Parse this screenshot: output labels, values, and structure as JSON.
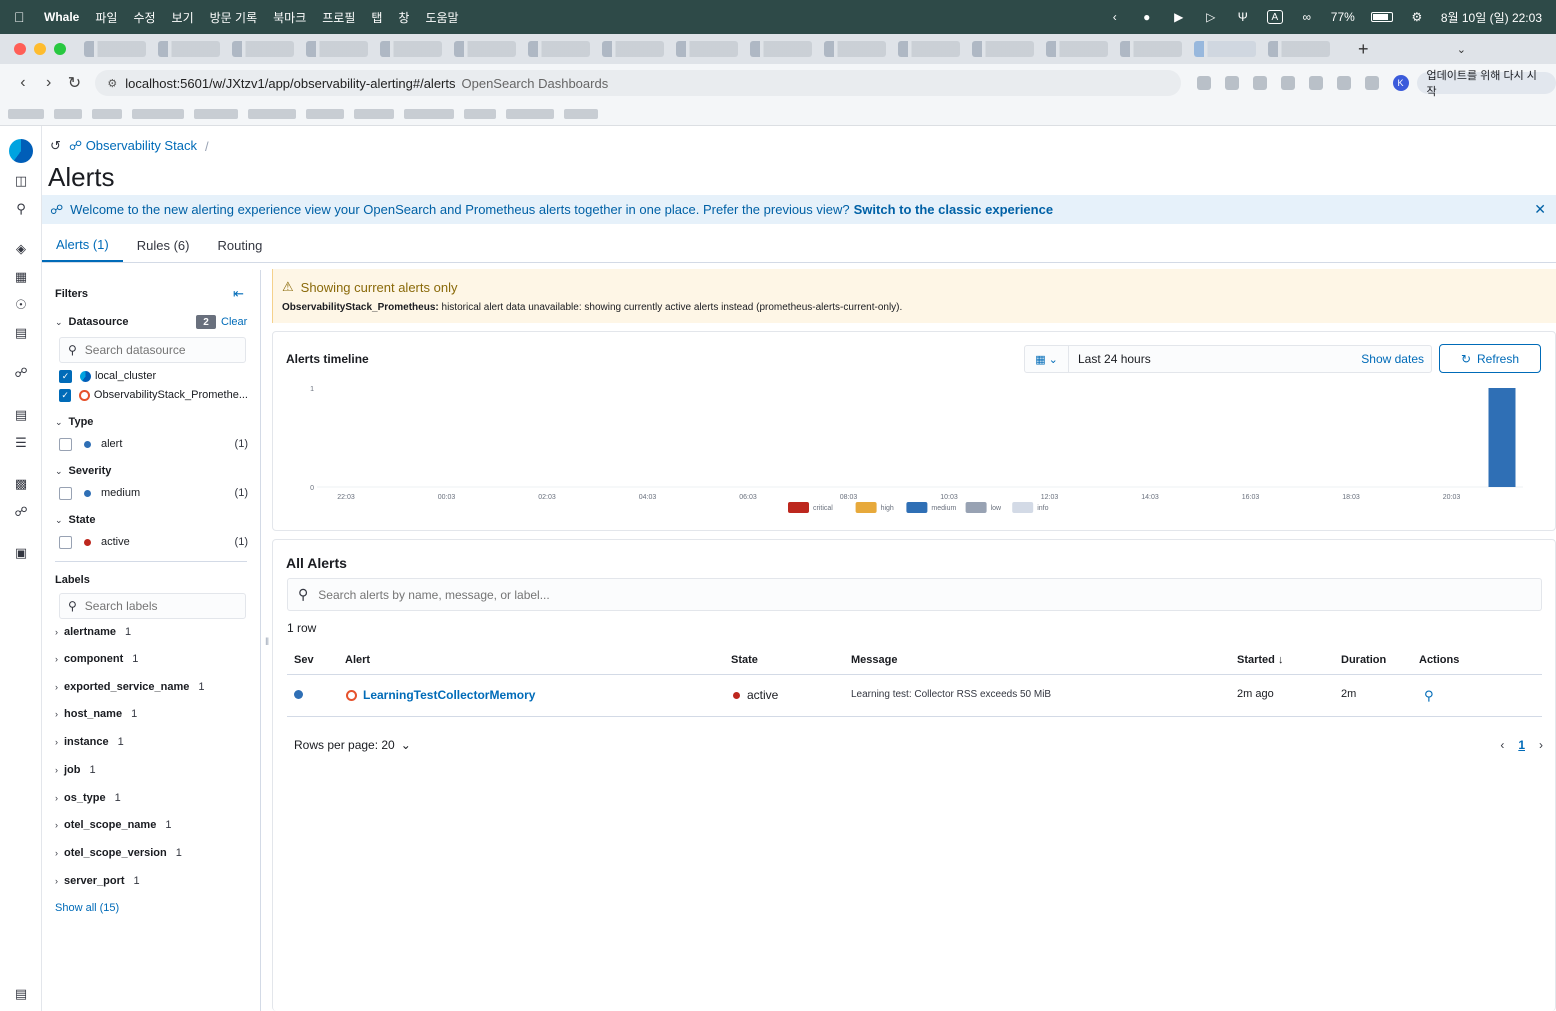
{
  "os_menubar": {
    "app_name": "Whale",
    "menus": [
      "파일",
      "수정",
      "보기",
      "방문 기록",
      "북마크",
      "프로필",
      "탭",
      "창",
      "도움말"
    ],
    "battery": "77%",
    "datetime": "8월 10일 (일) 22:03",
    "input_mode": "A"
  },
  "browser": {
    "url": "localhost:5601/w/JXtzv1/app/observability-alerting#/alerts",
    "site_name": "OpenSearch Dashboards",
    "update_button": "업데이트를 위해 다시 시작",
    "profile_initial": "K"
  },
  "breadcrumb": {
    "workspace": "Observability Stack",
    "separator": "/"
  },
  "page_title": "Alerts",
  "callout": {
    "text": "Welcome to the new alerting experience view your OpenSearch and Prometheus alerts together in one place. Prefer the previous view?",
    "link": "Switch to the classic experience"
  },
  "tabs": [
    {
      "label": "Alerts (1)",
      "active": true
    },
    {
      "label": "Rules (6)",
      "active": false
    },
    {
      "label": "Routing",
      "active": false
    }
  ],
  "filters": {
    "title": "Filters",
    "datasource": {
      "heading": "Datasource",
      "selected_count": "2",
      "clear_label": "Clear",
      "search_placeholder": "Search datasource",
      "items": [
        {
          "label": "local_cluster",
          "checked": true
        },
        {
          "label": "ObservabilityStack_Promethe...",
          "checked": true
        }
      ]
    },
    "type": {
      "heading": "Type",
      "items": [
        {
          "label": "alert",
          "count": "(1)",
          "color": "#2f6fb5"
        }
      ]
    },
    "severity": {
      "heading": "Severity",
      "items": [
        {
          "label": "medium",
          "count": "(1)",
          "color": "#2f6fb5"
        }
      ]
    },
    "state": {
      "heading": "State",
      "items": [
        {
          "label": "active",
          "count": "(1)",
          "color": "#bd271e"
        }
      ]
    },
    "labels": {
      "heading": "Labels",
      "search_placeholder": "Search labels",
      "items": [
        {
          "name": "alertname",
          "count": "1"
        },
        {
          "name": "component",
          "count": "1"
        },
        {
          "name": "exported_service_name",
          "count": "1"
        },
        {
          "name": "host_name",
          "count": "1"
        },
        {
          "name": "instance",
          "count": "1"
        },
        {
          "name": "job",
          "count": "1"
        },
        {
          "name": "os_type",
          "count": "1"
        },
        {
          "name": "otel_scope_name",
          "count": "1"
        },
        {
          "name": "otel_scope_version",
          "count": "1"
        },
        {
          "name": "server_port",
          "count": "1"
        }
      ],
      "show_all": "Show all (15)"
    }
  },
  "warning": {
    "title": "Showing current alerts only",
    "source": "ObservabilityStack_Prometheus:",
    "body": "historical alert data unavailable: showing currently active alerts instead (prometheus-alerts-current-only)."
  },
  "timeline": {
    "title": "Alerts timeline",
    "date_range": "Last 24 hours",
    "show_dates": "Show dates",
    "refresh": "Refresh"
  },
  "chart_data": {
    "type": "bar",
    "title": "Alerts timeline",
    "x_ticks": [
      "22:03",
      "00:03",
      "02:03",
      "04:03",
      "06:03",
      "08:03",
      "10:03",
      "12:03",
      "14:03",
      "16:03",
      "18:03",
      "20:03"
    ],
    "y_ticks": [
      "0",
      "1"
    ],
    "ylim": [
      0,
      1
    ],
    "legend_position": "bottom-center",
    "series": [
      {
        "name": "critical",
        "color": "#bd271e",
        "values": []
      },
      {
        "name": "high",
        "color": "#e7a93b",
        "values": []
      },
      {
        "name": "medium",
        "color": "#2f6fb5",
        "values": [
          {
            "x": "22:03",
            "y": 1
          }
        ]
      },
      {
        "name": "low",
        "color": "#98a2b3",
        "values": []
      },
      {
        "name": "info",
        "color": "#d3dae6",
        "values": []
      }
    ]
  },
  "alerts_table": {
    "title": "All Alerts",
    "search_placeholder": "Search alerts by name, message, or label...",
    "row_count": "1 row",
    "columns": {
      "sev": "Sev",
      "alert": "Alert",
      "state": "State",
      "message": "Message",
      "started": "Started",
      "duration": "Duration",
      "actions": "Actions"
    },
    "rows": [
      {
        "severity_color": "#2f6fb5",
        "alert": "LearningTestCollectorMemory",
        "state": "active",
        "state_color": "#bd271e",
        "message": "Learning test: Collector RSS exceeds 50 MiB",
        "started": "2m ago",
        "duration": "2m"
      }
    ],
    "rows_per_page": "Rows per page: 20",
    "current_page": "1"
  }
}
